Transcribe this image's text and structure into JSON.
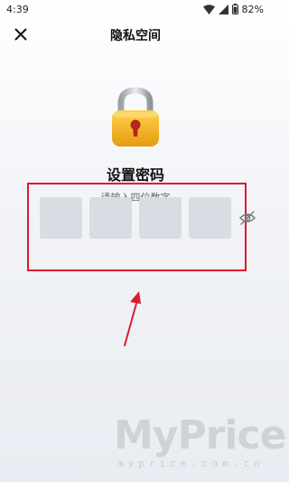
{
  "status_bar": {
    "time": "4:39",
    "battery": "82%"
  },
  "header": {
    "title": "隐私空间"
  },
  "main": {
    "heading": "设置密码",
    "hint": "请输入四位数字",
    "pin_boxes": [
      "",
      "",
      "",
      ""
    ]
  },
  "watermark": {
    "brand": "MyPrice",
    "url": "myprice.com.cn"
  },
  "colors": {
    "highlight": "#e0192f",
    "lock_body": "#f2b418",
    "pin_box": "#d9dce3"
  },
  "icons": [
    "close-icon",
    "wifi-icon",
    "signal-icon",
    "battery-icon",
    "lock-icon",
    "eye-off-icon",
    "arrow-icon"
  ]
}
